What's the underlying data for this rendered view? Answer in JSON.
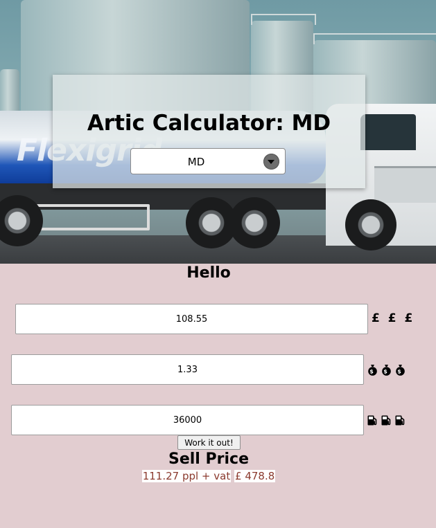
{
  "header": {
    "title": "Artic Calculator: MD",
    "brand_text": "Flexigrid",
    "depot_select": {
      "value": "MD"
    }
  },
  "main": {
    "greeting": "Hello",
    "fields": [
      {
        "value": "108.55",
        "suffix_text": "£ £ £",
        "suffix_icon": "pound-sign"
      },
      {
        "value": "1.33",
        "suffix_icon": "money-bag-icon",
        "suffix_count": 3
      },
      {
        "value": "36000",
        "suffix_icon": "fuel-pump-icon",
        "suffix_count": 3
      }
    ],
    "work_button_label": "Work it out!",
    "sell_price_title": "Sell Price",
    "result_ppl": "111.27 ppl + vat",
    "result_total": "£ 478.8"
  },
  "colors": {
    "page_background": "#e2cdd0",
    "result_text": "#8b3a2e"
  }
}
